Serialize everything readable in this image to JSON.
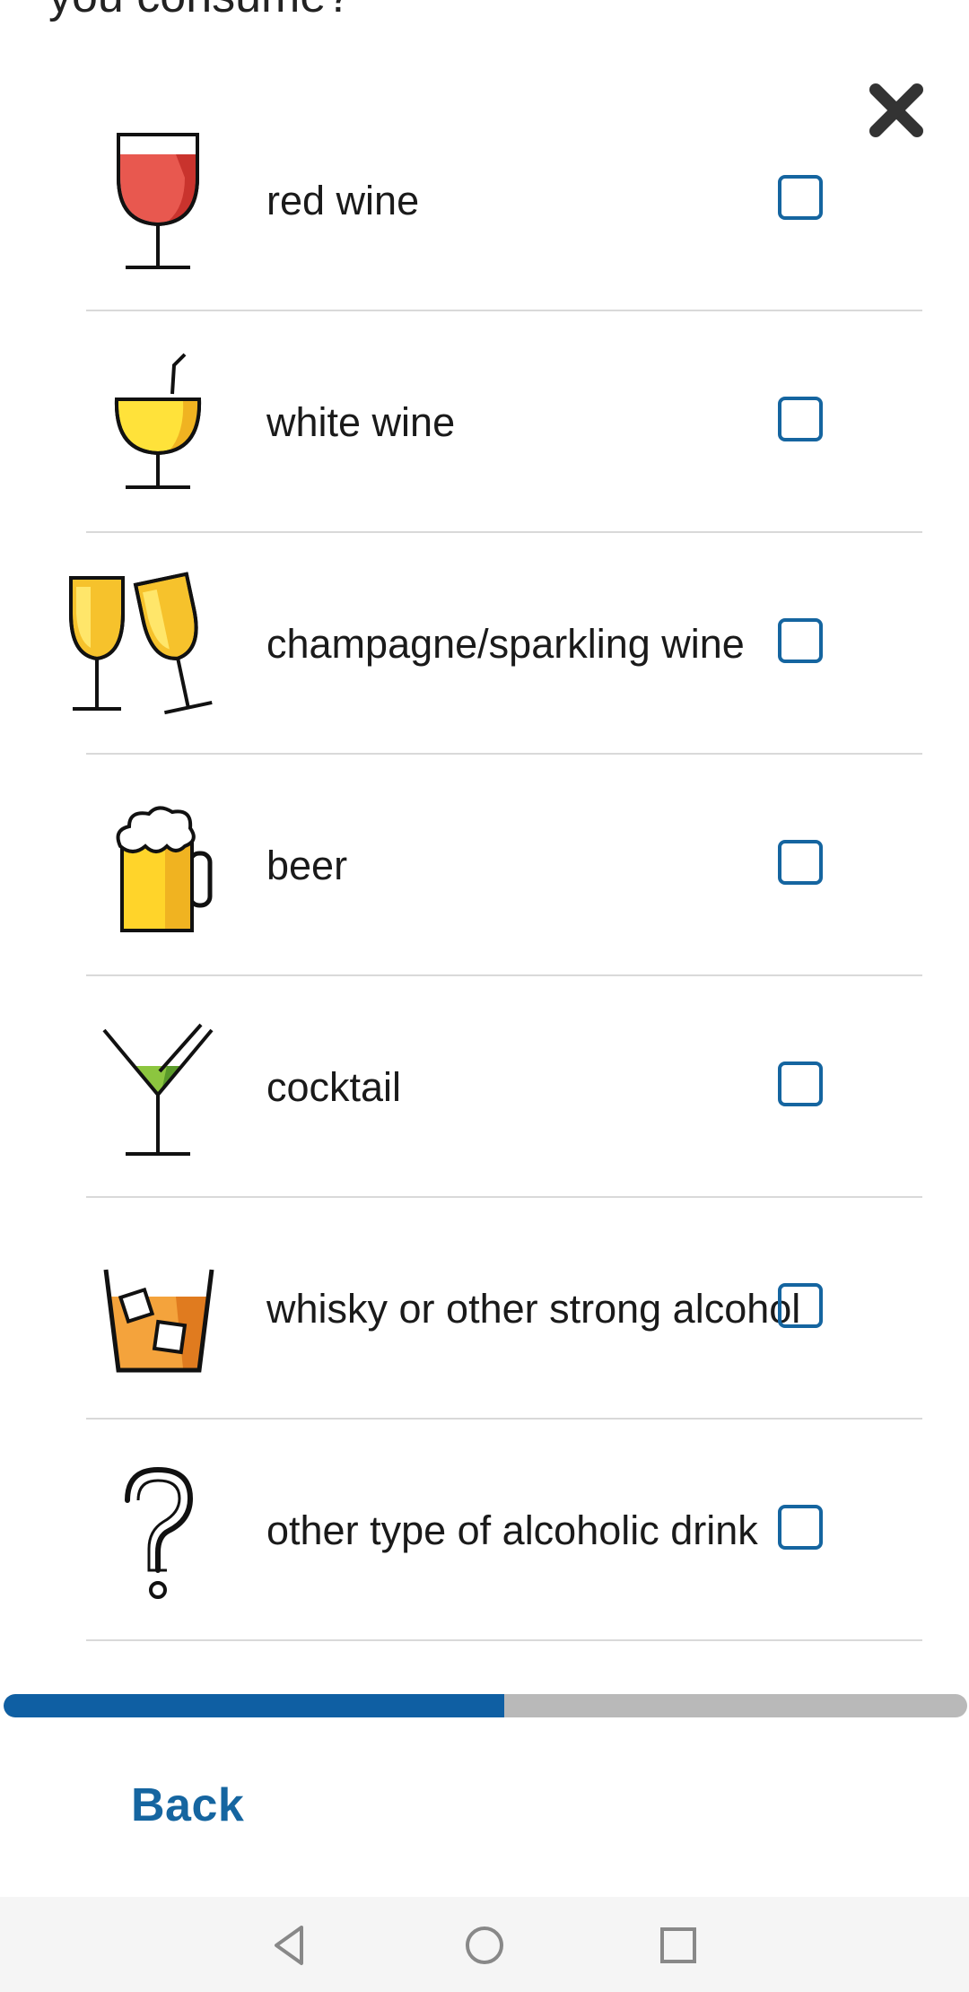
{
  "question": {
    "text": "you consume?"
  },
  "close": {
    "icon": "close-icon"
  },
  "options": [
    {
      "label": "red wine",
      "icon": "red-wine-icon",
      "checked": false
    },
    {
      "label": "white wine",
      "icon": "white-wine-icon",
      "checked": false
    },
    {
      "label": "champagne/sparkling wine",
      "icon": "champagne-icon",
      "checked": false
    },
    {
      "label": "beer",
      "icon": "beer-icon",
      "checked": false
    },
    {
      "label": "cocktail",
      "icon": "cocktail-icon",
      "checked": false
    },
    {
      "label": "whisky or other strong alcohol",
      "icon": "whisky-icon",
      "checked": false
    },
    {
      "label": "other type of alcoholic drink",
      "icon": "question-icon",
      "checked": false
    }
  ],
  "progress": {
    "fraction": 0.52,
    "fill_color": "#0f5fa3",
    "track_color": "#b9b9b9"
  },
  "footer": {
    "back_label": "Back"
  },
  "navbar": {
    "back_icon": "nav-back-icon",
    "home_icon": "nav-home-icon",
    "recents_icon": "nav-recents-icon"
  }
}
